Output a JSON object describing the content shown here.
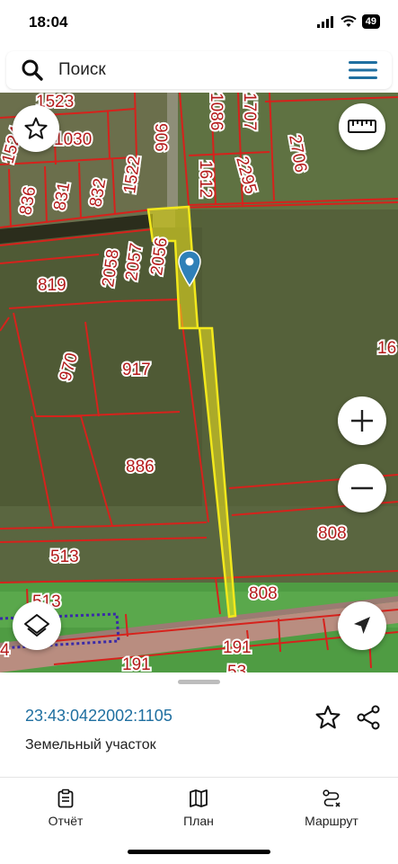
{
  "status": {
    "time": "18:04",
    "battery": "49"
  },
  "search": {
    "placeholder": "Поиск"
  },
  "map": {
    "labels": {
      "l1523": "1523",
      "l1524": "1524",
      "l1030": "1030",
      "l836": "836",
      "l831": "831",
      "l832": "832",
      "l1522": "1522",
      "l906": "906",
      "l1086": "1086",
      "l1707": "1707",
      "l1612": "1612",
      "l2295": "2295",
      "l2706": "2706",
      "l2058": "2058",
      "l2057": "2057",
      "l2056": "2056",
      "l819": "819",
      "l970": "970",
      "l917": "917",
      "l16": "16",
      "l886": "886",
      "l808a": "808",
      "l513a": "513",
      "l513b": "513",
      "l808b": "808",
      "l191a": "191",
      "l191b": "191",
      "l53": "53",
      "l4": "4"
    }
  },
  "parcel": {
    "cadastral_number": "23:43:0422002:1105",
    "type": "Земельный участок"
  },
  "nav": {
    "report": "Отчёт",
    "plan": "План",
    "route": "Маршрут"
  },
  "colors": {
    "boundary": "#d6221c",
    "selected": "#f2e81c",
    "pin": "#2f80b8",
    "accent": "#1f6fa0"
  }
}
